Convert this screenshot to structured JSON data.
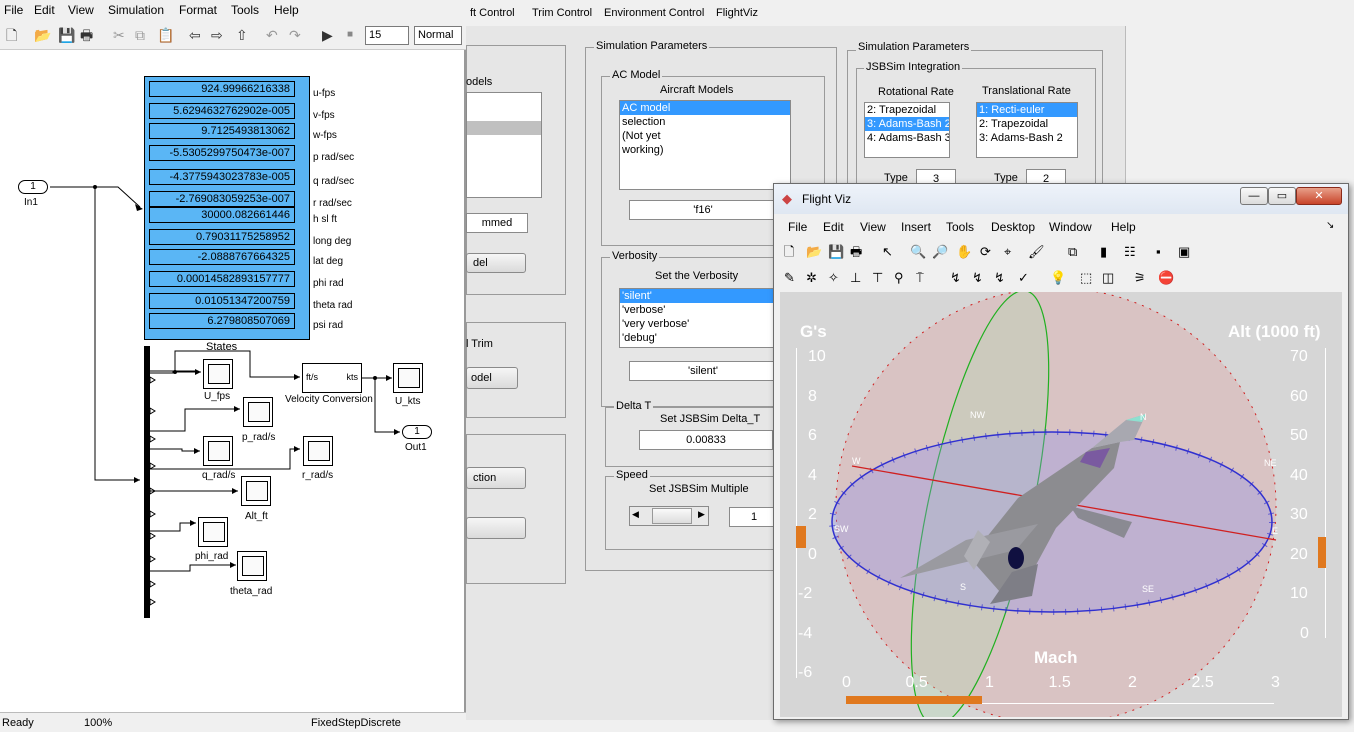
{
  "bg_window": {
    "menu": [
      "ft Control",
      "Trim Control",
      "Environment Control",
      "FlightViz"
    ],
    "left_partial": {
      "models_label": "odels",
      "trimmed_value": "mmed",
      "model_btn1": "del",
      "trim_label": "l Trim",
      "model_btn2": "odel",
      "action_btn": "ction"
    },
    "sim_params_1": {
      "title": "Simulation Parameters",
      "ac_model": {
        "title": "AC Model",
        "label": "Aircraft Models",
        "items": [
          "AC model",
          "selection",
          "(Not yet",
          "working)"
        ],
        "selected": 0,
        "value": "'f16'"
      },
      "verbosity": {
        "title": "Verbosity",
        "label": "Set the Verbosity",
        "items": [
          "'silent'",
          "'verbose'",
          "'very verbose'",
          "'debug'"
        ],
        "selected": 0,
        "value": "'silent'"
      },
      "delta_t": {
        "title": "Delta T",
        "label": "Set JSBSim Delta_T",
        "value": "0.00833"
      },
      "speed": {
        "title": "Speed",
        "label": "Set JSBSim Multiple",
        "value": "1"
      }
    },
    "sim_params_2": {
      "title": "Simulation Parameters",
      "integration": {
        "title": "JSBSim Integration",
        "rotational": {
          "label": "Rotational Rate",
          "items": [
            "2: Trapezoidal",
            "3: Adams-Bash 2",
            "4: Adams-Bash 3"
          ],
          "selected": 1,
          "type_label": "Type",
          "type_value": "3"
        },
        "translational": {
          "label": "Translational Rate",
          "items": [
            "1: Recti-euler",
            "2: Trapezoidal",
            "3: Adams-Bash 2"
          ],
          "selected": 0,
          "type_label": "Type",
          "type_value": "2"
        }
      }
    }
  },
  "simulink": {
    "menu": [
      "File",
      "Edit",
      "View",
      "Simulation",
      "Format",
      "Tools",
      "Help"
    ],
    "sim_time": "15",
    "sim_mode": "Normal",
    "status": {
      "state": "Ready",
      "zoom": "100%",
      "solver": "FixedStepDiscrete"
    },
    "display": [
      {
        "value": "924.99966216338",
        "label": "u-fps"
      },
      {
        "value": "5.6294632762902e-005",
        "label": "v-fps"
      },
      {
        "value": "9.7125493813062",
        "label": "w-fps"
      },
      {
        "value": "-5.5305299750473e-007",
        "label": "p rad/sec"
      },
      {
        "value": "-4.3775943023783e-005",
        "label": "q rad/sec"
      },
      {
        "value": "-2.769083059253e-007",
        "label": "r rad/sec"
      },
      {
        "value": "30000.082661446",
        "label": "h sl ft"
      },
      {
        "value": "0.79031175258952",
        "label": "long deg"
      },
      {
        "value": "-2.0888767664325",
        "label": "lat deg"
      },
      {
        "value": "0.00014582893157777",
        "label": "phi rad"
      },
      {
        "value": "0.01051347200759",
        "label": "theta rad"
      },
      {
        "value": "6.279808507069",
        "label": "psi rad"
      }
    ],
    "blocks": {
      "inport_num": "1",
      "inport_name": "In1",
      "states": "States",
      "u_fps": "U_fps",
      "p_rad": "p_rad/s",
      "q_rad": "q_rad/s",
      "r_rad": "r_rad/s",
      "alt": "Alt_ft",
      "phi": "phi_rad",
      "theta": "theta_rad",
      "vc_in": "ft/s",
      "vc_out": "kts",
      "vc_name": "Velocity Conversion",
      "u_kts": "U_kts",
      "outport_num": "1",
      "outport_name": "Out1"
    }
  },
  "flightviz": {
    "title": "Flight Viz",
    "menu": [
      "File",
      "Edit",
      "View",
      "Insert",
      "Tools",
      "Desktop",
      "Window",
      "Help"
    ],
    "hud": {
      "g_label": "G's",
      "g_ticks": [
        "10",
        "8",
        "6",
        "4",
        "2",
        "0",
        "-2",
        "-4",
        "-6"
      ],
      "alt_label": "Alt (1000 ft)",
      "alt_ticks": [
        "70",
        "60",
        "50",
        "40",
        "30",
        "20",
        "10",
        "0"
      ],
      "mach_label": "Mach",
      "mach_ticks": [
        "0",
        "0.5",
        "1",
        "1.5",
        "2",
        "2.5",
        "3"
      ],
      "compass": [
        "N",
        "NW",
        "W",
        "SW",
        "S",
        "SE",
        "E",
        "NE"
      ]
    },
    "colors": {
      "hud_text": "#ffffff",
      "gauge_orange": "#e0781e",
      "horizon_blue": "#3030d0",
      "meridian_red": "#d02020",
      "meridian_green": "#20b020"
    }
  }
}
